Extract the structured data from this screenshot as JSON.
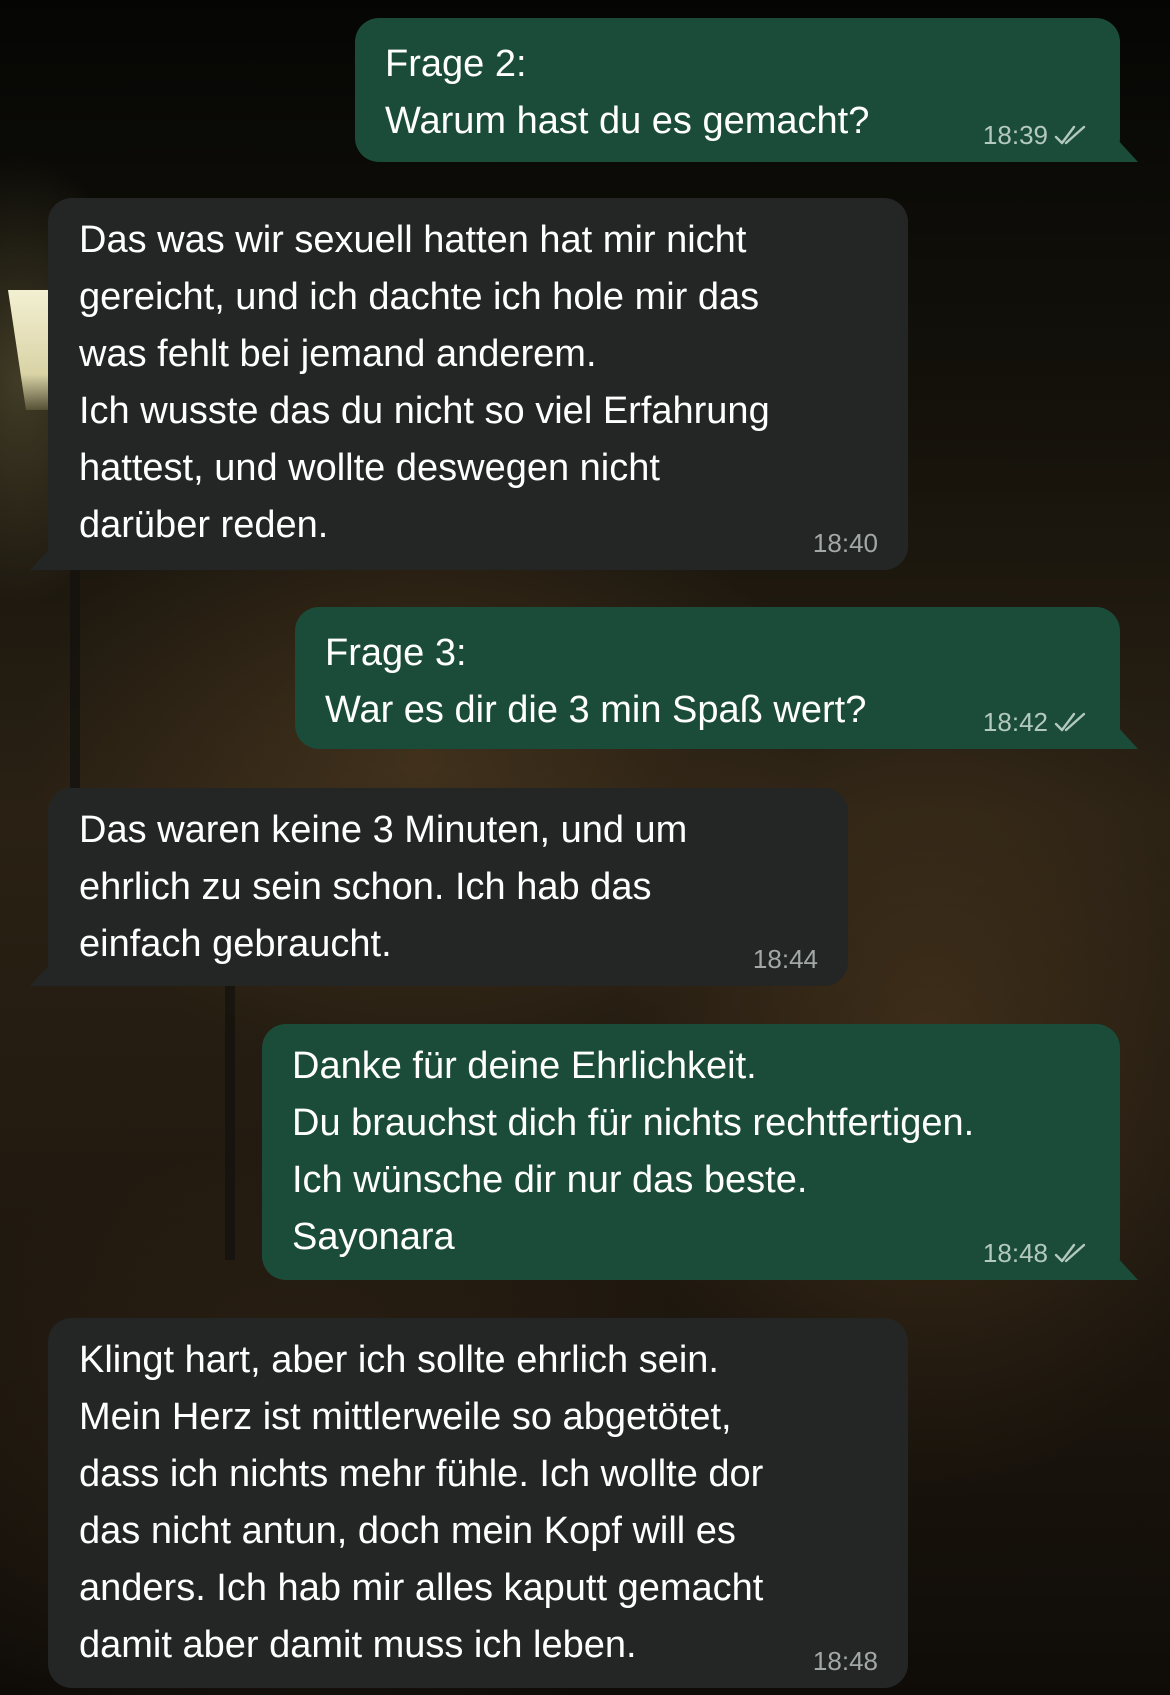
{
  "colors": {
    "incoming_bubble": "#242626",
    "outgoing_bubble": "#1b4c3a",
    "timestamp": "#a2a8a6"
  },
  "messages": [
    {
      "direction": "outgoing",
      "text": "Frage 2:\nWarum hast du es gemacht?",
      "time": "18:39",
      "status": "read-double-check"
    },
    {
      "direction": "incoming",
      "text": "Das was wir sexuell hatten hat mir nicht\ngereicht, und ich dachte ich hole mir das\nwas fehlt bei jemand anderem.\nIch wusste das du nicht so viel Erfahrung\nhattest, und wollte deswegen nicht\ndarüber reden.",
      "time": "18:40"
    },
    {
      "direction": "outgoing",
      "text": "Frage 3:\nWar es dir die 3 min Spaß wert?",
      "time": "18:42",
      "status": "read-double-check"
    },
    {
      "direction": "incoming",
      "text": "Das waren keine 3 Minuten, und um\nehrlich zu sein schon. Ich hab das\neinfach gebraucht.",
      "time": "18:44"
    },
    {
      "direction": "outgoing",
      "text": "Danke für deine Ehrlichkeit.\nDu brauchst dich für nichts rechtfertigen.\nIch wünsche dir nur das beste.\nSayonara",
      "time": "18:48",
      "status": "read-double-check"
    },
    {
      "direction": "incoming",
      "text": "Klingt hart, aber ich sollte ehrlich sein.\nMein Herz ist mittlerweile so abgetötet,\ndass ich nichts mehr fühle. Ich wollte dor\ndas nicht antun, doch mein Kopf will es\nanders. Ich hab mir alles kaputt gemacht\ndamit aber damit muss ich leben.",
      "time": "18:48"
    }
  ]
}
